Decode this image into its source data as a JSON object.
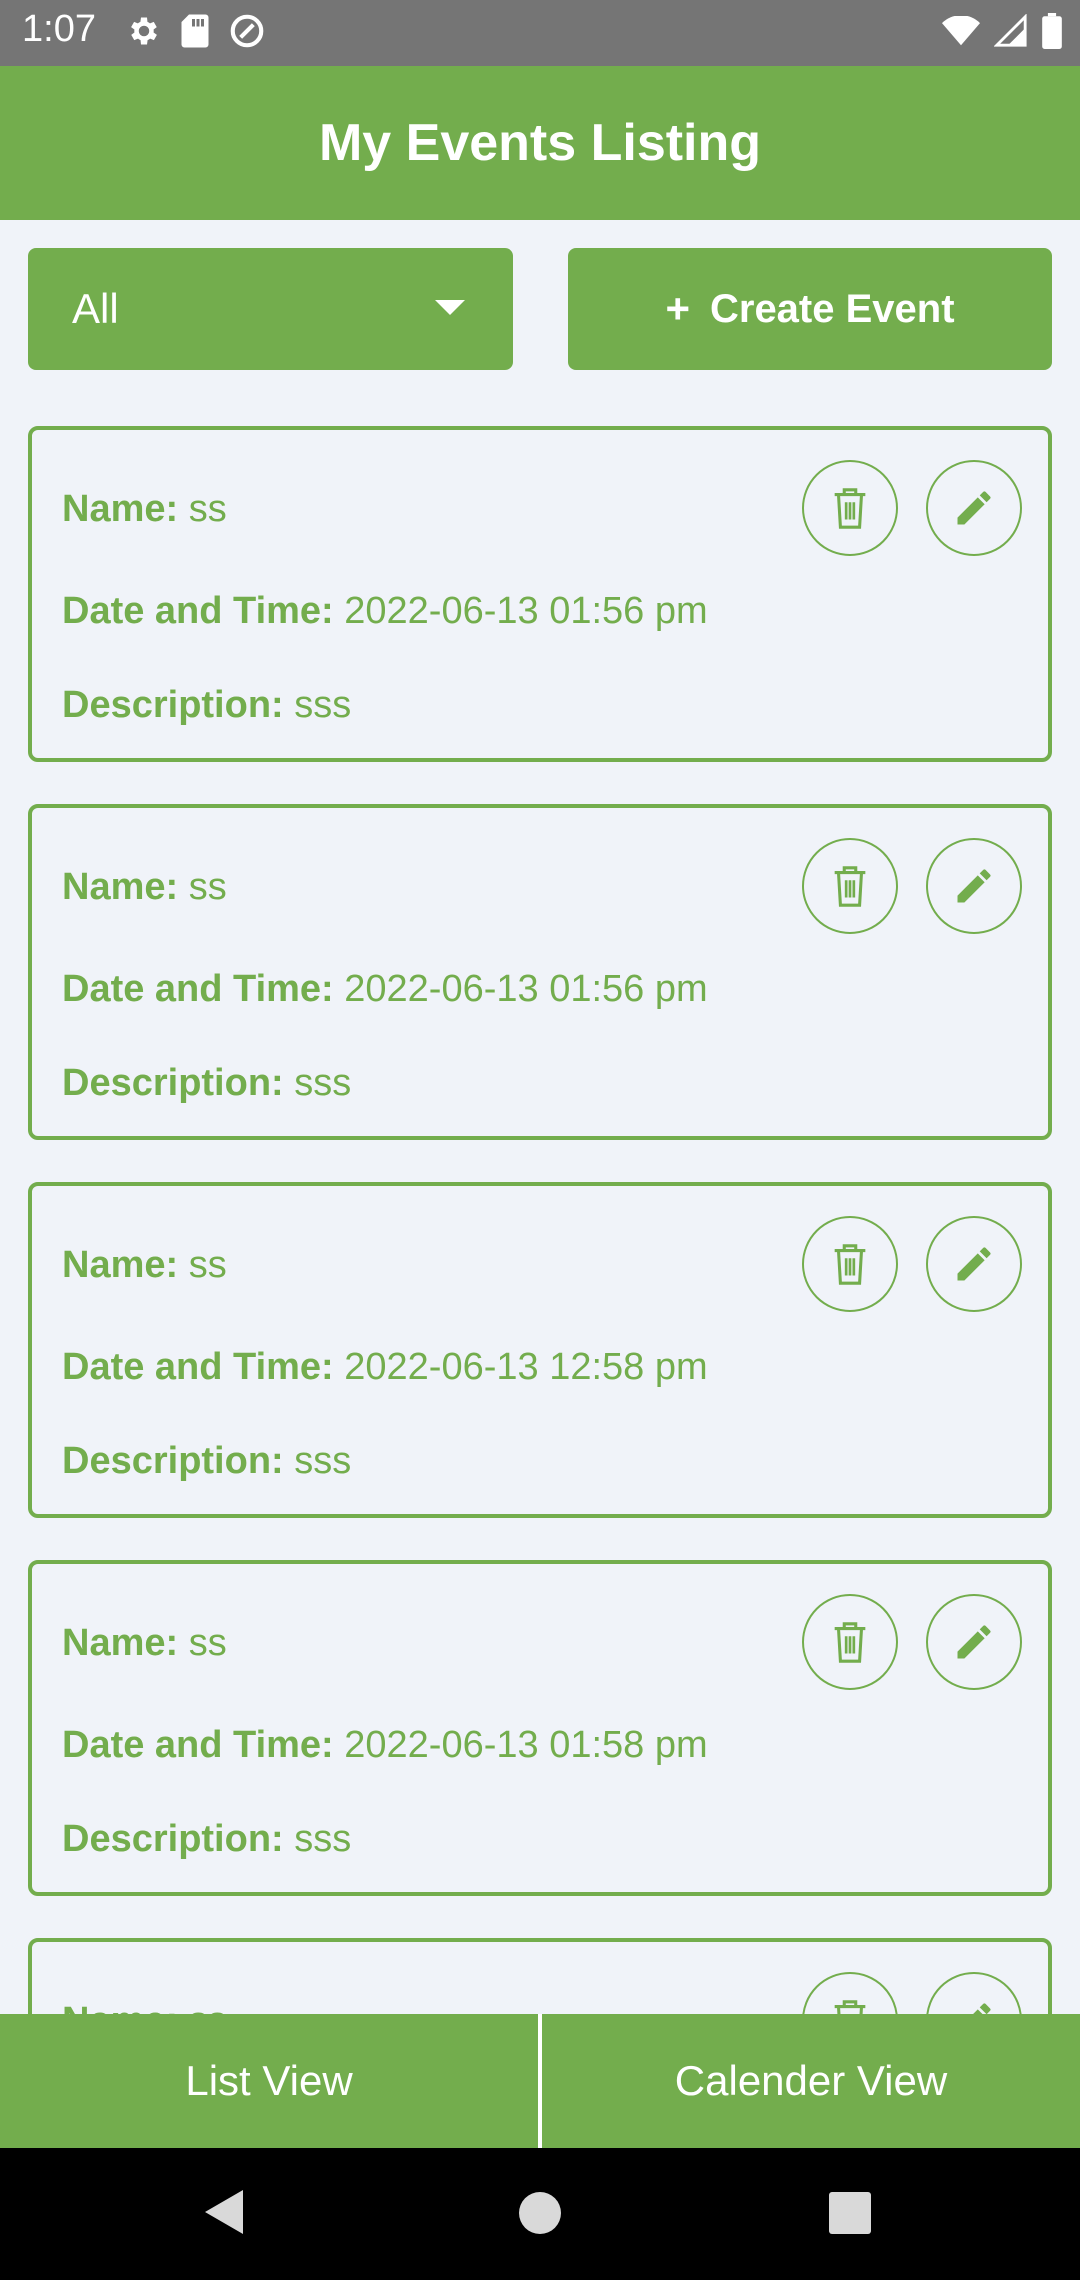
{
  "status_bar": {
    "time": "1:07"
  },
  "app_bar": {
    "title": "My Events Listing"
  },
  "filter": {
    "selected": "All"
  },
  "create_button": {
    "plus": "+",
    "label": "Create Event"
  },
  "labels": {
    "name": "Name:",
    "datetime": "Date and Time:",
    "description": "Description:"
  },
  "events": [
    {
      "name": "ss",
      "datetime": "2022-06-13 01:56 pm",
      "description": "sss"
    },
    {
      "name": "ss",
      "datetime": "2022-06-13 01:56 pm",
      "description": "sss"
    },
    {
      "name": "ss",
      "datetime": "2022-06-13 12:58 pm",
      "description": "sss"
    },
    {
      "name": "ss",
      "datetime": "2022-06-13 01:58 pm",
      "description": "sss"
    },
    {
      "name": "ss",
      "datetime": "",
      "description": ""
    }
  ],
  "bottom_tabs": {
    "list_view": "List View",
    "calendar_view": "Calender View"
  },
  "colors": {
    "primary": "#73ad4d",
    "background": "#f0f3f9",
    "status_bar": "#757575"
  }
}
